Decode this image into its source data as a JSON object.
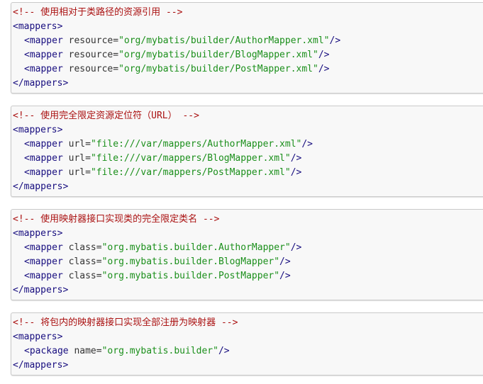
{
  "blocks": [
    {
      "comment": "<!-- 使用相对于类路径的资源引用 -->",
      "open": "<mappers>",
      "close": "</mappers>",
      "entries": [
        {
          "tag": "<mapper",
          "attr": "resource",
          "value": "\"org/mybatis/builder/AuthorMapper.xml\"",
          "end": "/>"
        },
        {
          "tag": "<mapper",
          "attr": "resource",
          "value": "\"org/mybatis/builder/BlogMapper.xml\"",
          "end": "/>"
        },
        {
          "tag": "<mapper",
          "attr": "resource",
          "value": "\"org/mybatis/builder/PostMapper.xml\"",
          "end": "/>"
        }
      ]
    },
    {
      "comment": "<!-- 使用完全限定资源定位符（URL） -->",
      "open": "<mappers>",
      "close": "</mappers>",
      "entries": [
        {
          "tag": "<mapper",
          "attr": "url",
          "value": "\"file:///var/mappers/AuthorMapper.xml\"",
          "end": "/>"
        },
        {
          "tag": "<mapper",
          "attr": "url",
          "value": "\"file:///var/mappers/BlogMapper.xml\"",
          "end": "/>"
        },
        {
          "tag": "<mapper",
          "attr": "url",
          "value": "\"file:///var/mappers/PostMapper.xml\"",
          "end": "/>"
        }
      ]
    },
    {
      "comment": "<!-- 使用映射器接口实现类的完全限定类名 -->",
      "open": "<mappers>",
      "close": "</mappers>",
      "entries": [
        {
          "tag": "<mapper",
          "attr": "class",
          "value": "\"org.mybatis.builder.AuthorMapper\"",
          "end": "/>"
        },
        {
          "tag": "<mapper",
          "attr": "class",
          "value": "\"org.mybatis.builder.BlogMapper\"",
          "end": "/>"
        },
        {
          "tag": "<mapper",
          "attr": "class",
          "value": "\"org.mybatis.builder.PostMapper\"",
          "end": "/>"
        }
      ]
    },
    {
      "comment": "<!-- 将包内的映射器接口实现全部注册为映射器 -->",
      "open": "<mappers>",
      "close": "</mappers>",
      "entries": [
        {
          "tag": "<package",
          "attr": "name",
          "value": "\"org.mybatis.builder\"",
          "end": "/>"
        }
      ]
    }
  ],
  "colors": {
    "comment": "#aa1111",
    "tag": "#170d7f",
    "string": "#1b8f1b",
    "background": "#f8f8f8",
    "border": "#c9c9c9"
  }
}
